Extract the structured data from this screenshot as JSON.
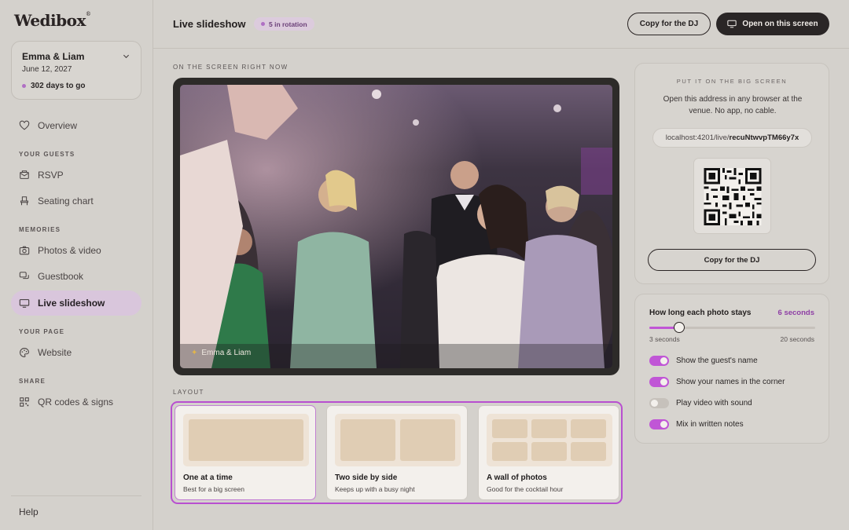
{
  "app": {
    "logo": "Wedibox",
    "logo_mark": "®"
  },
  "couple": {
    "names": "Emma & Liam",
    "date": "June 12, 2027",
    "countdown": "302 days to go"
  },
  "sidebar": {
    "overview": "Overview",
    "section_guests": "YOUR GUESTS",
    "rsvp": "RSVP",
    "seating": "Seating chart",
    "section_memories": "MEMORIES",
    "photos": "Photos & video",
    "guestbook": "Guestbook",
    "slideshow": "Live slideshow",
    "section_page": "YOUR PAGE",
    "website": "Website",
    "section_share": "SHARE",
    "qr": "QR codes & signs",
    "help": "Help"
  },
  "header": {
    "title": "Live slideshow",
    "rotation_badge": "5 in rotation",
    "copy_dj": "Copy for the DJ",
    "open_screen": "Open on this screen"
  },
  "main": {
    "now_label": "ON THE SCREEN RIGHT NOW",
    "photo_caption": "Emma & Liam",
    "layout_label": "LAYOUT",
    "layouts": [
      {
        "title": "One at a time",
        "subtitle": "Best for a big screen",
        "selected": true
      },
      {
        "title": "Two side by side",
        "subtitle": "Keeps up with a busy night",
        "selected": false
      },
      {
        "title": "A wall of photos",
        "subtitle": "Good for the cocktail hour",
        "selected": false
      }
    ]
  },
  "big_screen": {
    "label": "PUT IT ON THE BIG SCREEN",
    "description": "Open this address in any browser at the venue. No app, no cable.",
    "url_prefix": "localhost:4201/live/",
    "url_code": "recuNtwvpTM66y7x",
    "copy_dj": "Copy for the DJ"
  },
  "settings": {
    "duration_label": "How long each photo stays",
    "duration_value": "6 seconds",
    "duration_fraction": 0.18,
    "min_label": "3 seconds",
    "max_label": "20 seconds",
    "toggles": [
      {
        "label": "Show the guest's name",
        "on": true
      },
      {
        "label": "Show your names in the corner",
        "on": true
      },
      {
        "label": "Play video with sound",
        "on": false
      },
      {
        "label": "Mix in written notes",
        "on": true
      }
    ]
  },
  "colors": {
    "accent": "#c056d6",
    "accent_text": "#8e3fa5",
    "dark": "#2a2626",
    "background": "#d4d1cc"
  }
}
